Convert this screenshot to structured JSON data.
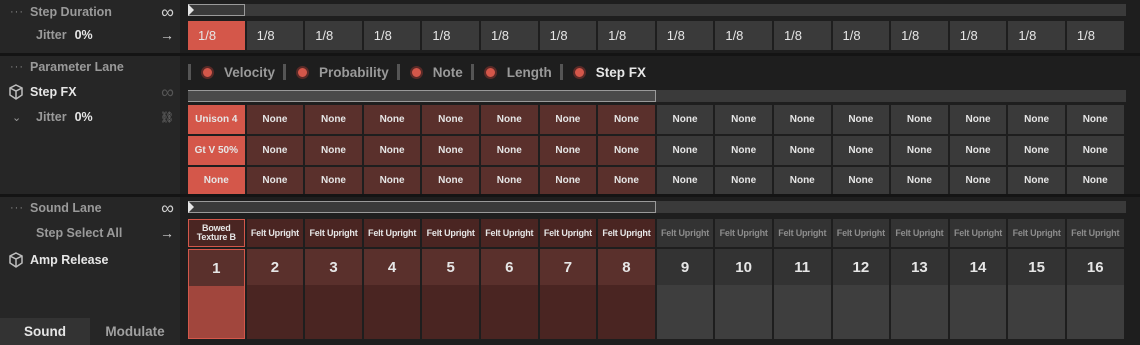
{
  "step_duration": {
    "label": "Step Duration",
    "jitter_label": "Jitter",
    "jitter_value": "0%",
    "values": [
      "1/8",
      "1/8",
      "1/8",
      "1/8",
      "1/8",
      "1/8",
      "1/8",
      "1/8",
      "1/8",
      "1/8",
      "1/8",
      "1/8",
      "1/8",
      "1/8",
      "1/8",
      "1/8"
    ],
    "selected_index": 0
  },
  "parameter_lane": {
    "label": "Parameter Lane",
    "title": "Step FX",
    "jitter_label": "Jitter",
    "jitter_value": "0%",
    "legend": [
      "Velocity",
      "Probability",
      "Note",
      "Length",
      "Step FX"
    ],
    "legend_active": "Step FX",
    "rows": [
      [
        "Unison 4",
        "None",
        "None",
        "None",
        "None",
        "None",
        "None",
        "None",
        "None",
        "None",
        "None",
        "None",
        "None",
        "None",
        "None",
        "None"
      ],
      [
        "Gt V 50%",
        "None",
        "None",
        "None",
        "None",
        "None",
        "None",
        "None",
        "None",
        "None",
        "None",
        "None",
        "None",
        "None",
        "None",
        "None"
      ],
      [
        "None",
        "None",
        "None",
        "None",
        "None",
        "None",
        "None",
        "None",
        "None",
        "None",
        "None",
        "None",
        "None",
        "None",
        "None",
        "None"
      ]
    ]
  },
  "sound_lane": {
    "label": "Sound Lane",
    "step_select": "Step Select All",
    "title": "Amp Release",
    "first_sound_line1": "Bowed",
    "first_sound_line2": "Texture B",
    "sounds": [
      "Felt Upright",
      "Felt Upright",
      "Felt Upright",
      "Felt Upright",
      "Felt Upright",
      "Felt Upright",
      "Felt Upright",
      "Felt Upright",
      "Felt Upright",
      "Felt Upright",
      "Felt Upright",
      "Felt Upright",
      "Felt Upright",
      "Felt Upright",
      "Felt Upright"
    ],
    "steps": [
      "1",
      "2",
      "3",
      "4",
      "5",
      "6",
      "7",
      "8",
      "9",
      "10",
      "11",
      "12",
      "13",
      "14",
      "15",
      "16"
    ],
    "active_steps": 8
  },
  "tabs": {
    "sound": "Sound",
    "modulate": "Modulate",
    "active": "Sound"
  },
  "icons": {
    "more": "more-dots-icon",
    "infinity": "infinity-icon",
    "arrow": "arrow-right-icon",
    "cube": "cube-icon",
    "chevron": "chevron-down-icon",
    "link": "link-icon"
  },
  "colors": {
    "accent": "#d4574a",
    "active_cell": "#5a302c",
    "inactive_cell": "#3a3a3a"
  }
}
